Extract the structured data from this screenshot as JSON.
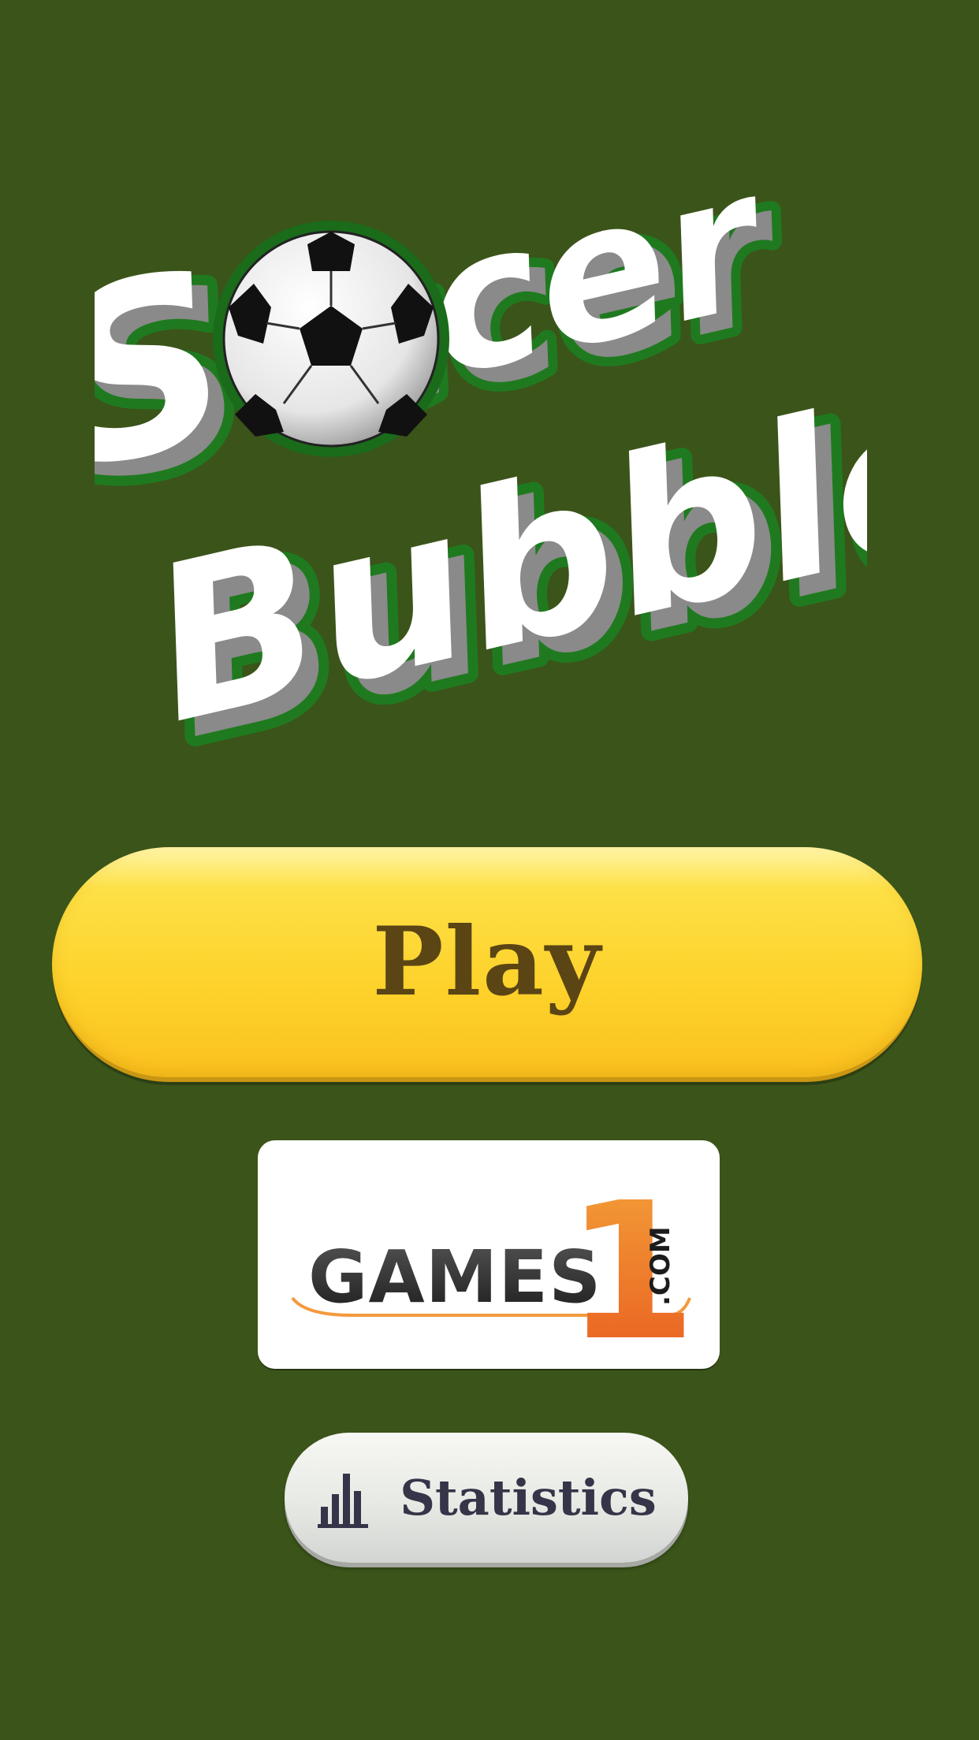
{
  "logo": {
    "line1_left": "S",
    "line1_right": "ccer",
    "line2": "Bubbles",
    "ball_icon": "soccer-ball-icon"
  },
  "menu": {
    "play_label": "Play",
    "sponsor": {
      "name": "GAMES",
      "digit": "1",
      "suffix": ".COM"
    },
    "statistics_label": "Statistics",
    "statistics_icon": "bar-chart-icon"
  },
  "colors": {
    "background": "#3b541a",
    "play_button": "#fdd22b",
    "play_text": "#5b4515",
    "logo_outline": "#1f7a1f",
    "sponsor_accent": "#f07820",
    "statistics_text": "#353448"
  }
}
